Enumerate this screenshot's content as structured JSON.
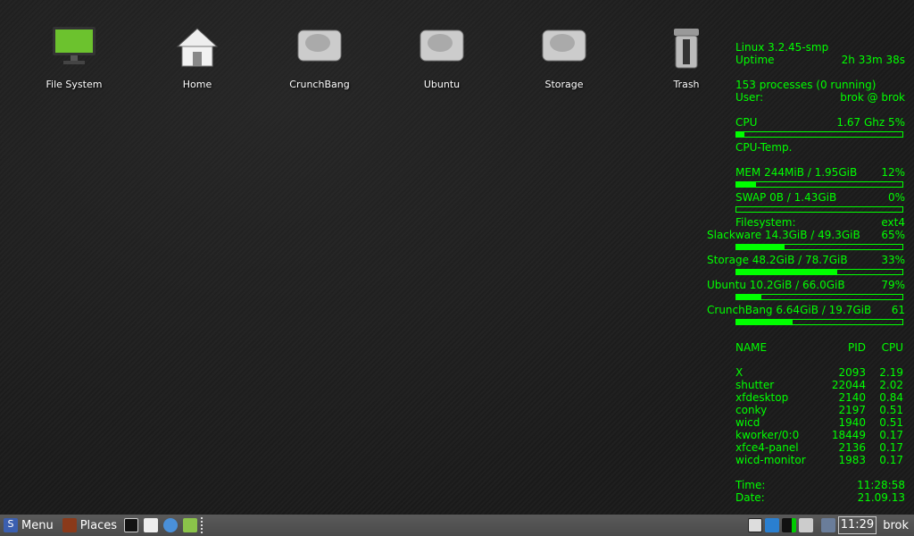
{
  "desktop_icons": [
    {
      "label": "File System",
      "icon": "monitor-icon"
    },
    {
      "label": "Home",
      "icon": "home-icon"
    },
    {
      "label": "CrunchBang",
      "icon": "drive-icon"
    },
    {
      "label": "Ubuntu",
      "icon": "drive-icon"
    },
    {
      "label": "Storage",
      "icon": "drive-icon"
    },
    {
      "label": "Trash",
      "icon": "trash-icon"
    }
  ],
  "conky": {
    "kernel": "Linux 3.2.45-smp",
    "uptime_label": "Uptime",
    "uptime": "2h 33m 38s",
    "processes": "153 processes (0 running)",
    "user_label": "User:",
    "user": "brok @ brok",
    "cpu_label": "CPU",
    "cpu_value": "1.67 Ghz 5%",
    "cpu_percent": 5,
    "cpu_temp_label": "CPU-Temp.",
    "mem_label": "MEM  244MiB / 1.95GiB",
    "mem_pct": "12%",
    "mem_percent": 12,
    "swap_label": "SWAP  0B   / 1.43GiB",
    "swap_pct": "0%",
    "swap_percent": 0,
    "fs_label": "Filesystem:",
    "fs_type": "ext4",
    "filesystems": [
      {
        "label": "Slackware  14.3GiB / 49.3GiB",
        "pct": "65%",
        "fill": 29
      },
      {
        "label": "Storage  48.2GiB / 78.7GiB",
        "pct": "33%",
        "fill": 61
      },
      {
        "label": "Ubuntu  10.2GiB / 66.0GiB",
        "pct": "79%",
        "fill": 15
      },
      {
        "label": "CrunchBang  6.64GiB / 19.7GiB",
        "pct": "61",
        "fill": 34
      }
    ],
    "proc_headers": [
      "NAME",
      "PID",
      "CPU"
    ],
    "procs": [
      [
        "X",
        "2093",
        "2.19"
      ],
      [
        "shutter",
        "22044",
        "2.02"
      ],
      [
        "xfdesktop",
        "2140",
        "0.84"
      ],
      [
        "conky",
        "2197",
        "0.51"
      ],
      [
        "wicd",
        "1940",
        "0.51"
      ],
      [
        "kworker/0:0",
        "18449",
        "0.17"
      ],
      [
        "xfce4-panel",
        "2136",
        "0.17"
      ],
      [
        "wicd-monitor",
        "1983",
        "0.17"
      ]
    ],
    "time_label": "Time:",
    "time": "11:28:58",
    "date_label": "Date:",
    "date": "21.09.13"
  },
  "panel": {
    "menu": "Menu",
    "places": "Places",
    "clock": "11:29",
    "user": "brok"
  }
}
